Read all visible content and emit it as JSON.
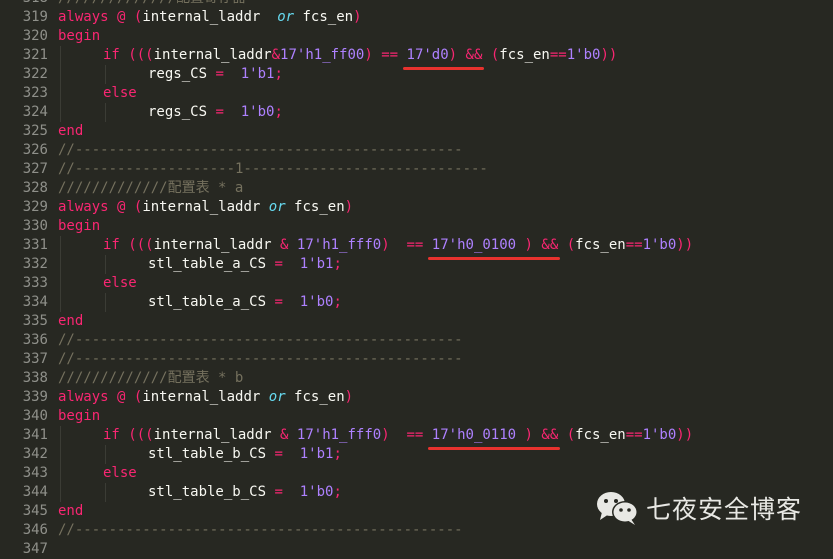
{
  "editor": {
    "theme_colors": {
      "background": "#272822",
      "keyword": "#f92672",
      "number": "#ae81ff",
      "builtin": "#66d9ef",
      "comment": "#75715e",
      "text": "#f8f8f2",
      "annotation": "#e8322e"
    },
    "lines": [
      {
        "no": "318",
        "tokens": [
          {
            "t": "//////////////配置寄存器",
            "c": "cm"
          }
        ]
      },
      {
        "no": "319",
        "tokens": [
          {
            "t": "always",
            "c": "kw"
          },
          {
            "t": " ",
            "c": "id"
          },
          {
            "t": "@",
            "c": "kw"
          },
          {
            "t": " ",
            "c": "id"
          },
          {
            "t": "(",
            "c": "op"
          },
          {
            "t": "internal_laddr  ",
            "c": "id"
          },
          {
            "t": "or",
            "c": "it"
          },
          {
            "t": " fcs_en",
            "c": "id"
          },
          {
            "t": ")",
            "c": "op"
          }
        ]
      },
      {
        "no": "320",
        "tokens": [
          {
            "t": "begin",
            "c": "kw"
          }
        ]
      },
      {
        "no": "321",
        "indent": 1,
        "tokens": [
          {
            "t": "if",
            "c": "kw"
          },
          {
            "t": " ",
            "c": "id"
          },
          {
            "t": "(((",
            "c": "op"
          },
          {
            "t": "internal_laddr",
            "c": "id"
          },
          {
            "t": "&",
            "c": "op"
          },
          {
            "t": "17'h1_ff00",
            "c": "num"
          },
          {
            "t": ")",
            "c": "op"
          },
          {
            "t": " ",
            "c": "id"
          },
          {
            "t": "==",
            "c": "op"
          },
          {
            "t": " ",
            "c": "id"
          },
          {
            "t": "17'd0",
            "c": "num"
          },
          {
            "t": ")",
            "c": "op"
          },
          {
            "t": " ",
            "c": "id"
          },
          {
            "t": "&&",
            "c": "op"
          },
          {
            "t": " ",
            "c": "id"
          },
          {
            "t": "(",
            "c": "op"
          },
          {
            "t": "fcs_en",
            "c": "id"
          },
          {
            "t": "==",
            "c": "op"
          },
          {
            "t": "1'b0",
            "c": "num"
          },
          {
            "t": "))",
            "c": "op"
          }
        ]
      },
      {
        "no": "322",
        "indent": 2,
        "tokens": [
          {
            "t": "regs_CS ",
            "c": "id"
          },
          {
            "t": "=",
            "c": "op"
          },
          {
            "t": "  ",
            "c": "id"
          },
          {
            "t": "1'b1",
            "c": "num"
          },
          {
            "t": ";",
            "c": "op"
          }
        ]
      },
      {
        "no": "323",
        "indent": 1,
        "tokens": [
          {
            "t": "else",
            "c": "kw"
          }
        ]
      },
      {
        "no": "324",
        "indent": 2,
        "tokens": [
          {
            "t": "regs_CS ",
            "c": "id"
          },
          {
            "t": "=",
            "c": "op"
          },
          {
            "t": "  ",
            "c": "id"
          },
          {
            "t": "1'b0",
            "c": "num"
          },
          {
            "t": ";",
            "c": "op"
          }
        ]
      },
      {
        "no": "325",
        "tokens": [
          {
            "t": "end",
            "c": "kw"
          }
        ]
      },
      {
        "no": "326",
        "tokens": [
          {
            "t": "//----------------------------------------------",
            "c": "cm"
          }
        ]
      },
      {
        "no": "327",
        "tokens": [
          {
            "t": "//-------------------1-----------------------------",
            "c": "cm"
          }
        ]
      },
      {
        "no": "328",
        "tokens": [
          {
            "t": "/////////////配置表 * a",
            "c": "cm"
          }
        ]
      },
      {
        "no": "329",
        "tokens": [
          {
            "t": "always",
            "c": "kw"
          },
          {
            "t": " ",
            "c": "id"
          },
          {
            "t": "@",
            "c": "kw"
          },
          {
            "t": " ",
            "c": "id"
          },
          {
            "t": "(",
            "c": "op"
          },
          {
            "t": "internal_laddr ",
            "c": "id"
          },
          {
            "t": "or",
            "c": "it"
          },
          {
            "t": " fcs_en",
            "c": "id"
          },
          {
            "t": ")",
            "c": "op"
          }
        ]
      },
      {
        "no": "330",
        "tokens": [
          {
            "t": "begin",
            "c": "kw"
          }
        ]
      },
      {
        "no": "331",
        "indent": 1,
        "tokens": [
          {
            "t": "if",
            "c": "kw"
          },
          {
            "t": " ",
            "c": "id"
          },
          {
            "t": "(((",
            "c": "op"
          },
          {
            "t": "internal_laddr ",
            "c": "id"
          },
          {
            "t": "&",
            "c": "op"
          },
          {
            "t": " ",
            "c": "id"
          },
          {
            "t": "17'h1_fff0",
            "c": "num"
          },
          {
            "t": ")",
            "c": "op"
          },
          {
            "t": "  ",
            "c": "id"
          },
          {
            "t": "==",
            "c": "op"
          },
          {
            "t": " ",
            "c": "id"
          },
          {
            "t": "17'h0_0100",
            "c": "num"
          },
          {
            "t": " ",
            "c": "id"
          },
          {
            "t": ")",
            "c": "op"
          },
          {
            "t": " ",
            "c": "id"
          },
          {
            "t": "&&",
            "c": "op"
          },
          {
            "t": " ",
            "c": "id"
          },
          {
            "t": "(",
            "c": "op"
          },
          {
            "t": "fcs_en",
            "c": "id"
          },
          {
            "t": "==",
            "c": "op"
          },
          {
            "t": "1'b0",
            "c": "num"
          },
          {
            "t": "))",
            "c": "op"
          }
        ]
      },
      {
        "no": "332",
        "indent": 2,
        "tokens": [
          {
            "t": "stl_table_a_CS ",
            "c": "id"
          },
          {
            "t": "=",
            "c": "op"
          },
          {
            "t": "  ",
            "c": "id"
          },
          {
            "t": "1'b1",
            "c": "num"
          },
          {
            "t": ";",
            "c": "op"
          }
        ]
      },
      {
        "no": "333",
        "indent": 1,
        "tokens": [
          {
            "t": "else",
            "c": "kw"
          }
        ]
      },
      {
        "no": "334",
        "indent": 2,
        "tokens": [
          {
            "t": "stl_table_a_CS ",
            "c": "id"
          },
          {
            "t": "=",
            "c": "op"
          },
          {
            "t": "  ",
            "c": "id"
          },
          {
            "t": "1'b0",
            "c": "num"
          },
          {
            "t": ";",
            "c": "op"
          }
        ]
      },
      {
        "no": "335",
        "tokens": [
          {
            "t": "end",
            "c": "kw"
          }
        ]
      },
      {
        "no": "336",
        "tokens": [
          {
            "t": "//----------------------------------------------",
            "c": "cm"
          }
        ]
      },
      {
        "no": "337",
        "tokens": [
          {
            "t": "//----------------------------------------------",
            "c": "cm"
          }
        ]
      },
      {
        "no": "338",
        "tokens": [
          {
            "t": "/////////////配置表 * b",
            "c": "cm"
          }
        ]
      },
      {
        "no": "339",
        "tokens": [
          {
            "t": "always",
            "c": "kw"
          },
          {
            "t": " ",
            "c": "id"
          },
          {
            "t": "@",
            "c": "kw"
          },
          {
            "t": " ",
            "c": "id"
          },
          {
            "t": "(",
            "c": "op"
          },
          {
            "t": "internal_laddr ",
            "c": "id"
          },
          {
            "t": "or",
            "c": "it"
          },
          {
            "t": " fcs_en",
            "c": "id"
          },
          {
            "t": ")",
            "c": "op"
          }
        ]
      },
      {
        "no": "340",
        "tokens": [
          {
            "t": "begin",
            "c": "kw"
          }
        ]
      },
      {
        "no": "341",
        "indent": 1,
        "tokens": [
          {
            "t": "if",
            "c": "kw"
          },
          {
            "t": " ",
            "c": "id"
          },
          {
            "t": "(((",
            "c": "op"
          },
          {
            "t": "internal_laddr ",
            "c": "id"
          },
          {
            "t": "&",
            "c": "op"
          },
          {
            "t": " ",
            "c": "id"
          },
          {
            "t": "17'h1_fff0",
            "c": "num"
          },
          {
            "t": ")",
            "c": "op"
          },
          {
            "t": "  ",
            "c": "id"
          },
          {
            "t": "==",
            "c": "op"
          },
          {
            "t": " ",
            "c": "id"
          },
          {
            "t": "17'h0_0110",
            "c": "num"
          },
          {
            "t": " ",
            "c": "id"
          },
          {
            "t": ")",
            "c": "op"
          },
          {
            "t": " ",
            "c": "id"
          },
          {
            "t": "&&",
            "c": "op"
          },
          {
            "t": " ",
            "c": "id"
          },
          {
            "t": "(",
            "c": "op"
          },
          {
            "t": "fcs_en",
            "c": "id"
          },
          {
            "t": "==",
            "c": "op"
          },
          {
            "t": "1'b0",
            "c": "num"
          },
          {
            "t": "))",
            "c": "op"
          }
        ]
      },
      {
        "no": "342",
        "indent": 2,
        "tokens": [
          {
            "t": "stl_table_b_CS ",
            "c": "id"
          },
          {
            "t": "=",
            "c": "op"
          },
          {
            "t": "  ",
            "c": "id"
          },
          {
            "t": "1'b1",
            "c": "num"
          },
          {
            "t": ";",
            "c": "op"
          }
        ]
      },
      {
        "no": "343",
        "indent": 1,
        "tokens": [
          {
            "t": "else",
            "c": "kw"
          }
        ]
      },
      {
        "no": "344",
        "indent": 2,
        "tokens": [
          {
            "t": "stl_table_b_CS ",
            "c": "id"
          },
          {
            "t": "=",
            "c": "op"
          },
          {
            "t": "  ",
            "c": "id"
          },
          {
            "t": "1'b0",
            "c": "num"
          },
          {
            "t": ";",
            "c": "op"
          }
        ]
      },
      {
        "no": "345",
        "tokens": [
          {
            "t": "end",
            "c": "kw"
          }
        ]
      },
      {
        "no": "346",
        "tokens": [
          {
            "t": "//----------------------------------------------",
            "c": "cm"
          }
        ]
      },
      {
        "no": "347",
        "tokens": []
      }
    ],
    "annotations": [
      {
        "line": "321",
        "target": "17'd0) &&"
      },
      {
        "line": "331",
        "target": "17'h0_0100 )"
      },
      {
        "line": "341",
        "target": "17'h0_0110 )"
      }
    ]
  },
  "watermark": {
    "icon": "wechat-icon",
    "text": "七夜安全博客"
  }
}
